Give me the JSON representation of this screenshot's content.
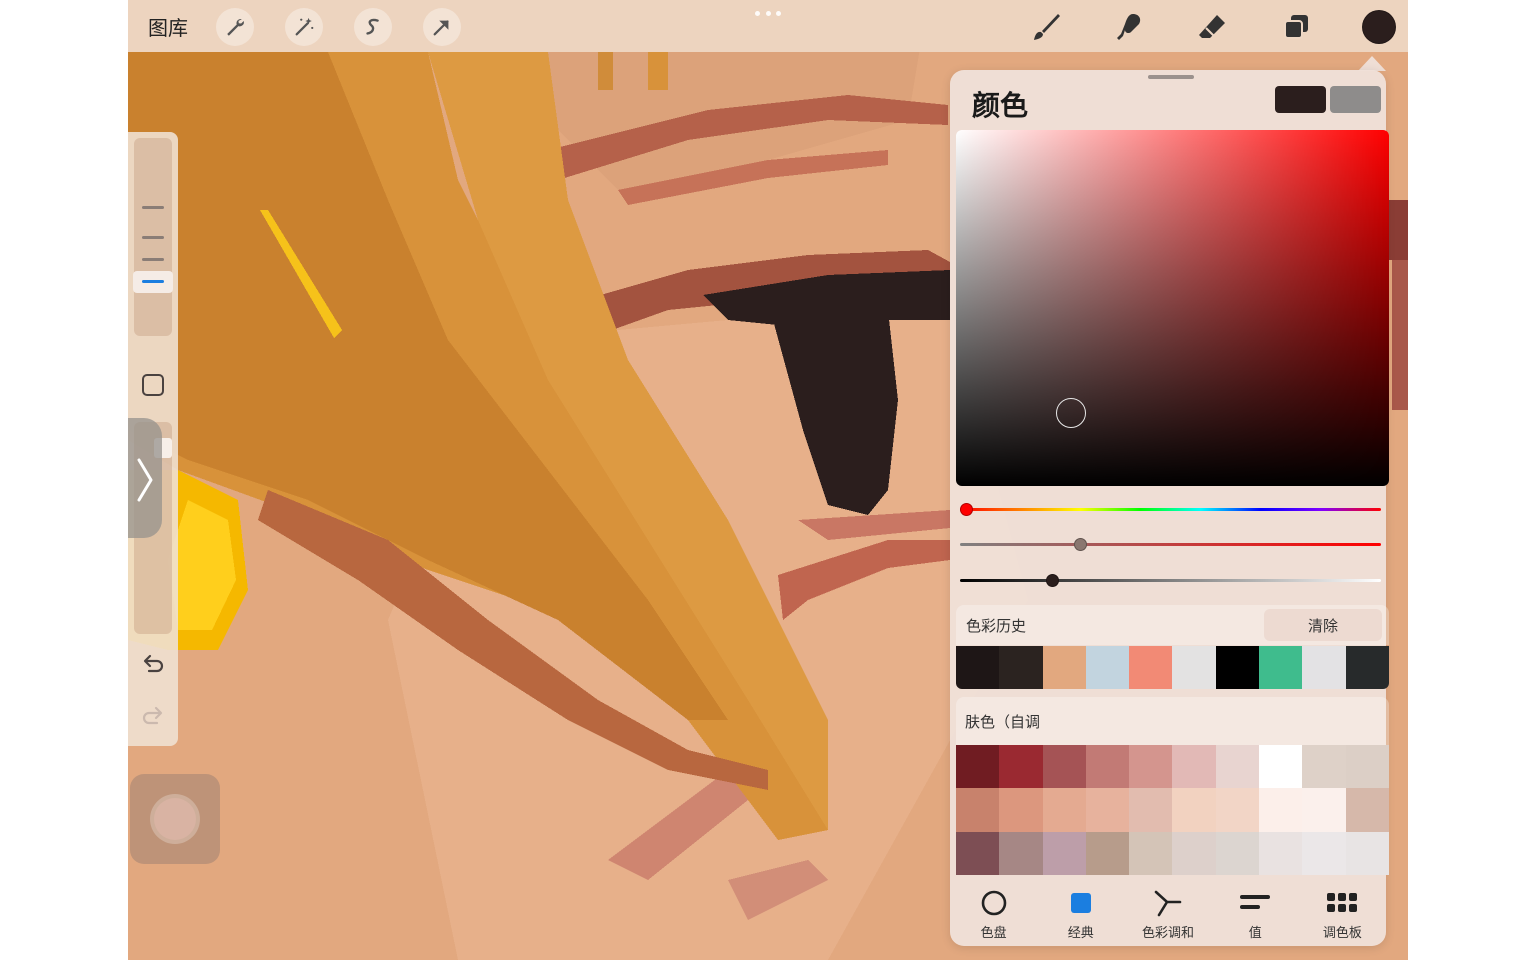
{
  "topbar": {
    "gallery_label": "图库",
    "tools_left": [
      {
        "name": "adjustments-icon"
      },
      {
        "name": "magic-wand-icon"
      },
      {
        "name": "selection-icon"
      },
      {
        "name": "transform-arrow-icon"
      }
    ],
    "tools_right": [
      {
        "name": "brush-icon"
      },
      {
        "name": "smudge-icon"
      },
      {
        "name": "eraser-icon"
      },
      {
        "name": "layers-icon"
      }
    ],
    "current_color": "#2b1e1d"
  },
  "sidebar": {
    "brush_size_level": 0.7,
    "icons": [
      "modify-square-icon",
      "undo-icon",
      "redo-icon",
      "collapse-chevron-icon"
    ]
  },
  "color_panel": {
    "title": "颜色",
    "primary_color": "#2b1e1d",
    "secondary_color": "#8e8c8b",
    "hue_level": 0.0,
    "saturation_level": 0.28,
    "brightness_level": 0.21,
    "history": {
      "label": "色彩历史",
      "clear_label": "清除",
      "swatches": [
        "#1e1616",
        "#2b2320",
        "#e2a87f",
        "#c2d4df",
        "#f28a75",
        "#e3e2e2",
        "#000000",
        "#3fbc8d",
        "#e3e2e4",
        "#272a2b"
      ]
    },
    "palette": {
      "label": "肤色（自调",
      "swatches": [
        "#701c22",
        "#9a2931",
        "#a55355",
        "#c27a75",
        "#d4958e",
        "#e2b9b6",
        "#e8d4d0",
        "#ffffff",
        "#ded1c8",
        "#dccfc6",
        "#c8826c",
        "#dc977e",
        "#e4aa91",
        "#e7b29d",
        "#e2bcaf",
        "#f2d2c0",
        "#f2d5c6",
        "#fcefea",
        "#fbf0ec",
        "#d6b8aa",
        "#7d4e54",
        "#a68785",
        "#bd9ea9",
        "#b79c8b",
        "#d4c4b7",
        "#ddd0cb",
        "#dcd5d0",
        "#e9e2e1",
        "#ebe7e8",
        "#e8e4e4"
      ]
    },
    "tabs": [
      {
        "label": "色盘",
        "icon": "color-disc-icon"
      },
      {
        "label": "经典",
        "icon": "classic-square-icon",
        "active": true
      },
      {
        "label": "色彩调和",
        "icon": "harmony-icon"
      },
      {
        "label": "值",
        "icon": "value-sliders-icon"
      },
      {
        "label": "调色板",
        "icon": "palettes-grid-icon"
      }
    ],
    "accent_color": "#1b7ee0"
  }
}
